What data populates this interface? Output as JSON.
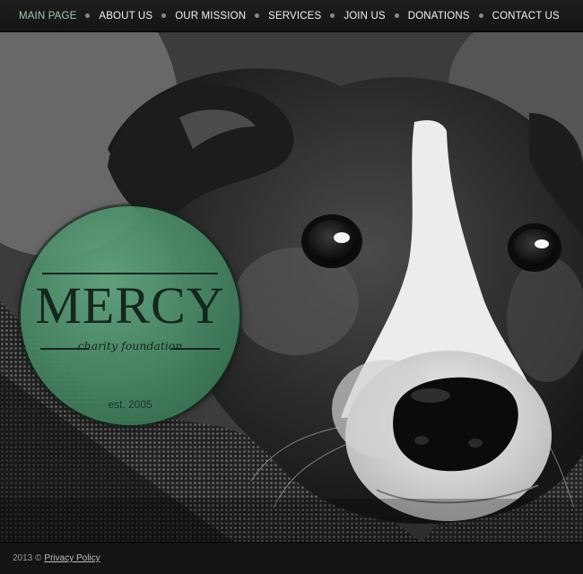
{
  "nav": {
    "items": [
      {
        "label": "MAIN PAGE"
      },
      {
        "label": "ABOUT US"
      },
      {
        "label": "OUR MISSION"
      },
      {
        "label": "SERVICES"
      },
      {
        "label": "JOIN US"
      },
      {
        "label": "DONATIONS"
      },
      {
        "label": "CONTACT US"
      }
    ]
  },
  "badge": {
    "title": "MERCY",
    "subtitle": "charity foundation",
    "established": "est. 2005"
  },
  "footer": {
    "copyright": "2013 ©",
    "privacy_link": "Privacy Policy"
  },
  "colors": {
    "accent": "#9fc9b1",
    "badge_green": "#4f9672",
    "nav_bg": "#1a1a1a"
  }
}
